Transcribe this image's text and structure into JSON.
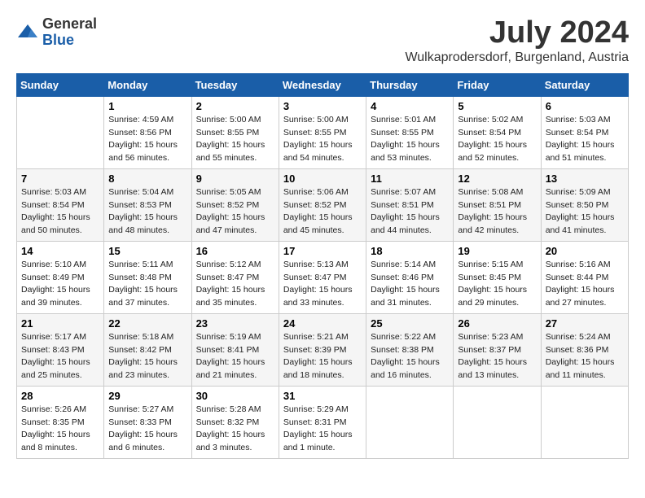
{
  "logo": {
    "general": "General",
    "blue": "Blue"
  },
  "title": "July 2024",
  "subtitle": "Wulkaprodersdorf, Burgenland, Austria",
  "days_header": [
    "Sunday",
    "Monday",
    "Tuesday",
    "Wednesday",
    "Thursday",
    "Friday",
    "Saturday"
  ],
  "weeks": [
    [
      {
        "day": "",
        "info": ""
      },
      {
        "day": "1",
        "info": "Sunrise: 4:59 AM\nSunset: 8:56 PM\nDaylight: 15 hours\nand 56 minutes."
      },
      {
        "day": "2",
        "info": "Sunrise: 5:00 AM\nSunset: 8:55 PM\nDaylight: 15 hours\nand 55 minutes."
      },
      {
        "day": "3",
        "info": "Sunrise: 5:00 AM\nSunset: 8:55 PM\nDaylight: 15 hours\nand 54 minutes."
      },
      {
        "day": "4",
        "info": "Sunrise: 5:01 AM\nSunset: 8:55 PM\nDaylight: 15 hours\nand 53 minutes."
      },
      {
        "day": "5",
        "info": "Sunrise: 5:02 AM\nSunset: 8:54 PM\nDaylight: 15 hours\nand 52 minutes."
      },
      {
        "day": "6",
        "info": "Sunrise: 5:03 AM\nSunset: 8:54 PM\nDaylight: 15 hours\nand 51 minutes."
      }
    ],
    [
      {
        "day": "7",
        "info": "Sunrise: 5:03 AM\nSunset: 8:54 PM\nDaylight: 15 hours\nand 50 minutes."
      },
      {
        "day": "8",
        "info": "Sunrise: 5:04 AM\nSunset: 8:53 PM\nDaylight: 15 hours\nand 48 minutes."
      },
      {
        "day": "9",
        "info": "Sunrise: 5:05 AM\nSunset: 8:52 PM\nDaylight: 15 hours\nand 47 minutes."
      },
      {
        "day": "10",
        "info": "Sunrise: 5:06 AM\nSunset: 8:52 PM\nDaylight: 15 hours\nand 45 minutes."
      },
      {
        "day": "11",
        "info": "Sunrise: 5:07 AM\nSunset: 8:51 PM\nDaylight: 15 hours\nand 44 minutes."
      },
      {
        "day": "12",
        "info": "Sunrise: 5:08 AM\nSunset: 8:51 PM\nDaylight: 15 hours\nand 42 minutes."
      },
      {
        "day": "13",
        "info": "Sunrise: 5:09 AM\nSunset: 8:50 PM\nDaylight: 15 hours\nand 41 minutes."
      }
    ],
    [
      {
        "day": "14",
        "info": "Sunrise: 5:10 AM\nSunset: 8:49 PM\nDaylight: 15 hours\nand 39 minutes."
      },
      {
        "day": "15",
        "info": "Sunrise: 5:11 AM\nSunset: 8:48 PM\nDaylight: 15 hours\nand 37 minutes."
      },
      {
        "day": "16",
        "info": "Sunrise: 5:12 AM\nSunset: 8:47 PM\nDaylight: 15 hours\nand 35 minutes."
      },
      {
        "day": "17",
        "info": "Sunrise: 5:13 AM\nSunset: 8:47 PM\nDaylight: 15 hours\nand 33 minutes."
      },
      {
        "day": "18",
        "info": "Sunrise: 5:14 AM\nSunset: 8:46 PM\nDaylight: 15 hours\nand 31 minutes."
      },
      {
        "day": "19",
        "info": "Sunrise: 5:15 AM\nSunset: 8:45 PM\nDaylight: 15 hours\nand 29 minutes."
      },
      {
        "day": "20",
        "info": "Sunrise: 5:16 AM\nSunset: 8:44 PM\nDaylight: 15 hours\nand 27 minutes."
      }
    ],
    [
      {
        "day": "21",
        "info": "Sunrise: 5:17 AM\nSunset: 8:43 PM\nDaylight: 15 hours\nand 25 minutes."
      },
      {
        "day": "22",
        "info": "Sunrise: 5:18 AM\nSunset: 8:42 PM\nDaylight: 15 hours\nand 23 minutes."
      },
      {
        "day": "23",
        "info": "Sunrise: 5:19 AM\nSunset: 8:41 PM\nDaylight: 15 hours\nand 21 minutes."
      },
      {
        "day": "24",
        "info": "Sunrise: 5:21 AM\nSunset: 8:39 PM\nDaylight: 15 hours\nand 18 minutes."
      },
      {
        "day": "25",
        "info": "Sunrise: 5:22 AM\nSunset: 8:38 PM\nDaylight: 15 hours\nand 16 minutes."
      },
      {
        "day": "26",
        "info": "Sunrise: 5:23 AM\nSunset: 8:37 PM\nDaylight: 15 hours\nand 13 minutes."
      },
      {
        "day": "27",
        "info": "Sunrise: 5:24 AM\nSunset: 8:36 PM\nDaylight: 15 hours\nand 11 minutes."
      }
    ],
    [
      {
        "day": "28",
        "info": "Sunrise: 5:26 AM\nSunset: 8:35 PM\nDaylight: 15 hours\nand 8 minutes."
      },
      {
        "day": "29",
        "info": "Sunrise: 5:27 AM\nSunset: 8:33 PM\nDaylight: 15 hours\nand 6 minutes."
      },
      {
        "day": "30",
        "info": "Sunrise: 5:28 AM\nSunset: 8:32 PM\nDaylight: 15 hours\nand 3 minutes."
      },
      {
        "day": "31",
        "info": "Sunrise: 5:29 AM\nSunset: 8:31 PM\nDaylight: 15 hours\nand 1 minute."
      },
      {
        "day": "",
        "info": ""
      },
      {
        "day": "",
        "info": ""
      },
      {
        "day": "",
        "info": ""
      }
    ]
  ]
}
